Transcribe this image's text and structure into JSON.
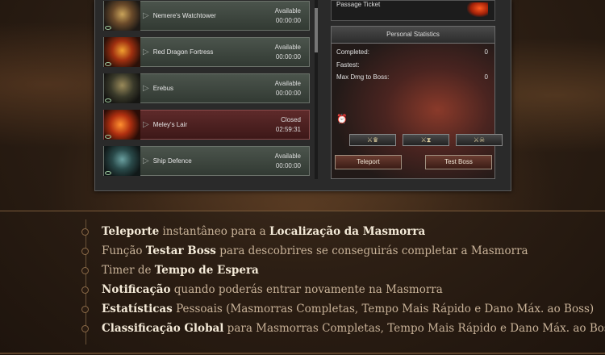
{
  "dungeons": [
    {
      "name": "Nemere's Watchtower",
      "status": "Available",
      "timer": "00:00:00",
      "closed": false
    },
    {
      "name": "Red Dragon Fortress",
      "status": "Available",
      "timer": "00:00:00",
      "closed": false
    },
    {
      "name": "Erebus",
      "status": "Available",
      "timer": "00:00:00",
      "closed": false
    },
    {
      "name": "Meley's Lair",
      "status": "Closed",
      "timer": "02:59:31",
      "closed": true
    },
    {
      "name": "Ship Defence",
      "status": "Available",
      "timer": "00:00:00",
      "closed": false
    }
  ],
  "ticket": {
    "label": "Passage Ticket"
  },
  "stats": {
    "title": "Personal Statistics",
    "completed_label": "Completed:",
    "completed_value": "0",
    "fastest_label": "Fastest:",
    "fastest_value": "",
    "maxdmg_label": "Max Dmg to Boss:",
    "maxdmg_value": "0"
  },
  "buttons": {
    "teleport": "Teleport",
    "test_boss": "Test Boss"
  },
  "features": [
    {
      "b1": "Teleporte",
      "t1": " instantâneo para a ",
      "b2": "Localização da Masmorra",
      "t2": ""
    },
    {
      "b1": "",
      "t1": "Função ",
      "b2": "Testar Boss",
      "t2": " para descobrires se conseguirás completar a Masmorra"
    },
    {
      "b1": "",
      "t1": "Timer de ",
      "b2": "Tempo de Espera",
      "t2": ""
    },
    {
      "b1": "Notificação",
      "t1": " quando poderás entrar novamente na Masmorra",
      "b2": "",
      "t2": ""
    },
    {
      "b1": "Estatísticas",
      "t1": " Pessoais (Masmorras Completas, Tempo Mais Rápido e Dano Máx. ao Boss)",
      "b2": "",
      "t2": ""
    },
    {
      "b1": "Classificação Global",
      "t1": " para Masmorras Completas, Tempo Mais Rápido e Dano Máx. ao Boss",
      "b2": "",
      "t2": ""
    }
  ]
}
